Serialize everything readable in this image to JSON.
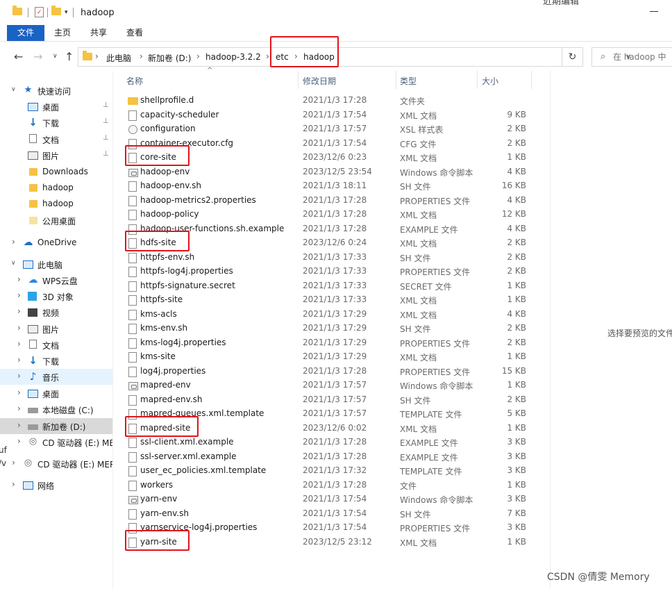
{
  "window": {
    "title": "hadoop",
    "title_clipped": "近期编辑"
  },
  "ribbon": {
    "tabs": [
      {
        "label": "文件",
        "active": true
      },
      {
        "label": "主页",
        "active": false
      },
      {
        "label": "共享",
        "active": false
      },
      {
        "label": "查看",
        "active": false
      }
    ]
  },
  "nav": {
    "back": "←",
    "forward": "→",
    "dropdown": "∨",
    "up": "↑"
  },
  "address": {
    "crumbs": [
      "此电脑",
      "新加卷 (D:)",
      "hadoop-3.2.2",
      "etc",
      "hadoop"
    ],
    "separator": "›",
    "dropdown": "∨",
    "refresh": "↻"
  },
  "search": {
    "icon": "⌕",
    "placeholder": "在 hadoop 中"
  },
  "sidebar": {
    "items": [
      {
        "label": "快速访问",
        "icon": "star-icon",
        "arrow": "∨",
        "pinned": false
      },
      {
        "label": "桌面",
        "icon": "desktop-icon",
        "pinned": true
      },
      {
        "label": "下载",
        "icon": "download-icon",
        "pinned": true
      },
      {
        "label": "文档",
        "icon": "document-icon",
        "pinned": true
      },
      {
        "label": "图片",
        "icon": "picture-icon",
        "pinned": true
      },
      {
        "label": "Downloads",
        "icon": "folder-icon"
      },
      {
        "label": "hadoop",
        "icon": "folder-icon"
      },
      {
        "label": "hadoop",
        "icon": "folder-icon"
      },
      {
        "label": "公用桌面",
        "icon": "folder-icon"
      },
      {
        "label": "OneDrive",
        "icon": "cloud-icon",
        "arrow": "›"
      },
      {
        "label": "此电脑",
        "icon": "computer-icon",
        "arrow": "∨"
      },
      {
        "label": "WPS云盘",
        "icon": "wps-cloud-icon",
        "arrow": "›"
      },
      {
        "label": "3D 对象",
        "icon": "cube-icon",
        "arrow": "›"
      },
      {
        "label": "视频",
        "icon": "video-icon",
        "arrow": "›"
      },
      {
        "label": "图片",
        "icon": "picture-icon",
        "arrow": "›"
      },
      {
        "label": "文档",
        "icon": "document-icon",
        "arrow": "›"
      },
      {
        "label": "下载",
        "icon": "download-icon",
        "arrow": "›"
      },
      {
        "label": "音乐",
        "icon": "music-icon",
        "arrow": "›",
        "hovered": true
      },
      {
        "label": "桌面",
        "icon": "desktop-icon",
        "arrow": "›"
      },
      {
        "label": "本地磁盘 (C:)",
        "icon": "drive-icon",
        "arrow": "›"
      },
      {
        "label": "新加卷 (D:)",
        "icon": "drive-icon",
        "arrow": "›",
        "selected": true
      },
      {
        "label": "CD 驱动器 (E:) ME",
        "icon": "cd-drive-icon",
        "arrow": "›"
      },
      {
        "label": "CD 驱动器 (E:) MER",
        "icon": "cd-drive-icon",
        "arrow": "›"
      },
      {
        "label": "网络",
        "icon": "network-icon",
        "arrow": "›"
      }
    ],
    "pin_glyph": "⊥"
  },
  "edge_fragments": [
    "uf",
    "/v"
  ],
  "columns": {
    "name": "名称",
    "date": "修改日期",
    "type": "类型",
    "size": "大小",
    "sort_caret": "^"
  },
  "files": [
    {
      "name": "shellprofile.d",
      "date": "2021/1/3 17:28",
      "type": "文件夹",
      "size": "",
      "icon": "folder"
    },
    {
      "name": "capacity-scheduler",
      "date": "2021/1/3 17:54",
      "type": "XML 文档",
      "size": "9 KB",
      "icon": "file"
    },
    {
      "name": "configuration",
      "date": "2021/1/3 17:57",
      "type": "XSL 样式表",
      "size": "2 KB",
      "icon": "xsl"
    },
    {
      "name": "container-executor.cfg",
      "date": "2021/1/3 17:54",
      "type": "CFG 文件",
      "size": "2 KB",
      "icon": "file"
    },
    {
      "name": "core-site",
      "date": "2023/12/6 0:23",
      "type": "XML 文档",
      "size": "1 KB",
      "icon": "file",
      "highlight": true
    },
    {
      "name": "hadoop-env",
      "date": "2023/12/5 23:54",
      "type": "Windows 命令脚本",
      "size": "4 KB",
      "icon": "cmd"
    },
    {
      "name": "hadoop-env.sh",
      "date": "2021/1/3 18:11",
      "type": "SH 文件",
      "size": "16 KB",
      "icon": "file"
    },
    {
      "name": "hadoop-metrics2.properties",
      "date": "2021/1/3 17:28",
      "type": "PROPERTIES 文件",
      "size": "4 KB",
      "icon": "file"
    },
    {
      "name": "hadoop-policy",
      "date": "2021/1/3 17:28",
      "type": "XML 文档",
      "size": "12 KB",
      "icon": "file"
    },
    {
      "name": "hadoop-user-functions.sh.example",
      "date": "2021/1/3 17:28",
      "type": "EXAMPLE 文件",
      "size": "4 KB",
      "icon": "file"
    },
    {
      "name": "hdfs-site",
      "date": "2023/12/6 0:24",
      "type": "XML 文档",
      "size": "2 KB",
      "icon": "file",
      "highlight": true
    },
    {
      "name": "httpfs-env.sh",
      "date": "2021/1/3 17:33",
      "type": "SH 文件",
      "size": "2 KB",
      "icon": "file"
    },
    {
      "name": "httpfs-log4j.properties",
      "date": "2021/1/3 17:33",
      "type": "PROPERTIES 文件",
      "size": "2 KB",
      "icon": "file"
    },
    {
      "name": "httpfs-signature.secret",
      "date": "2021/1/3 17:33",
      "type": "SECRET 文件",
      "size": "1 KB",
      "icon": "file"
    },
    {
      "name": "httpfs-site",
      "date": "2021/1/3 17:33",
      "type": "XML 文档",
      "size": "1 KB",
      "icon": "file"
    },
    {
      "name": "kms-acls",
      "date": "2021/1/3 17:29",
      "type": "XML 文档",
      "size": "4 KB",
      "icon": "file"
    },
    {
      "name": "kms-env.sh",
      "date": "2021/1/3 17:29",
      "type": "SH 文件",
      "size": "2 KB",
      "icon": "file"
    },
    {
      "name": "kms-log4j.properties",
      "date": "2021/1/3 17:29",
      "type": "PROPERTIES 文件",
      "size": "2 KB",
      "icon": "file"
    },
    {
      "name": "kms-site",
      "date": "2021/1/3 17:29",
      "type": "XML 文档",
      "size": "1 KB",
      "icon": "file"
    },
    {
      "name": "log4j.properties",
      "date": "2021/1/3 17:28",
      "type": "PROPERTIES 文件",
      "size": "15 KB",
      "icon": "file"
    },
    {
      "name": "mapred-env",
      "date": "2021/1/3 17:57",
      "type": "Windows 命令脚本",
      "size": "1 KB",
      "icon": "cmd"
    },
    {
      "name": "mapred-env.sh",
      "date": "2021/1/3 17:57",
      "type": "SH 文件",
      "size": "2 KB",
      "icon": "file"
    },
    {
      "name": "mapred-queues.xml.template",
      "date": "2021/1/3 17:57",
      "type": "TEMPLATE 文件",
      "size": "5 KB",
      "icon": "file"
    },
    {
      "name": "mapred-site",
      "date": "2023/12/6 0:02",
      "type": "XML 文档",
      "size": "1 KB",
      "icon": "file",
      "highlight": true
    },
    {
      "name": "ssl-client.xml.example",
      "date": "2021/1/3 17:28",
      "type": "EXAMPLE 文件",
      "size": "3 KB",
      "icon": "file"
    },
    {
      "name": "ssl-server.xml.example",
      "date": "2021/1/3 17:28",
      "type": "EXAMPLE 文件",
      "size": "3 KB",
      "icon": "file"
    },
    {
      "name": "user_ec_policies.xml.template",
      "date": "2021/1/3 17:32",
      "type": "TEMPLATE 文件",
      "size": "3 KB",
      "icon": "file"
    },
    {
      "name": "workers",
      "date": "2021/1/3 17:28",
      "type": "文件",
      "size": "1 KB",
      "icon": "file"
    },
    {
      "name": "yarn-env",
      "date": "2021/1/3 17:54",
      "type": "Windows 命令脚本",
      "size": "3 KB",
      "icon": "cmd"
    },
    {
      "name": "yarn-env.sh",
      "date": "2021/1/3 17:54",
      "type": "SH 文件",
      "size": "7 KB",
      "icon": "file"
    },
    {
      "name": "yarnservice-log4j.properties",
      "date": "2021/1/3 17:54",
      "type": "PROPERTIES 文件",
      "size": "3 KB",
      "icon": "file"
    },
    {
      "name": "yarn-site",
      "date": "2023/12/5 23:12",
      "type": "XML 文档",
      "size": "1 KB",
      "icon": "file",
      "highlight": true
    }
  ],
  "preview": {
    "message": "选择要预览的文件"
  },
  "watermark": "CSDN @倩雯 Memory",
  "colors": {
    "accent": "#1a63c5",
    "highlight": "#e3131c",
    "folder": "#f5c242"
  }
}
